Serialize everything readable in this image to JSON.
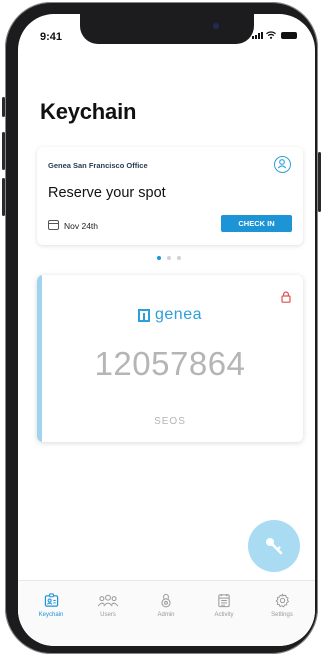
{
  "status_bar": {
    "time": "9:41"
  },
  "page": {
    "title": "Keychain"
  },
  "reservation_card": {
    "office": "Genea San Francisco Office",
    "heading": "Reserve your spot",
    "date": "Nov 24th",
    "checkin_label": "CHECK IN"
  },
  "pager": {
    "count": 3,
    "active": 1
  },
  "access_card": {
    "brand": "Genea",
    "brand_text": "Genea",
    "number": "12057864",
    "technology": "SEOS"
  },
  "tabs": [
    {
      "label": "Keychain",
      "icon": "badge-icon",
      "active": true
    },
    {
      "label": "Users",
      "icon": "users-icon",
      "active": false
    },
    {
      "label": "Admin",
      "icon": "admin-icon",
      "active": false
    },
    {
      "label": "Activity",
      "icon": "activity-icon",
      "active": false
    },
    {
      "label": "Settings",
      "icon": "gear-icon",
      "active": false
    }
  ],
  "colors": {
    "accent": "#1c94d6",
    "fab": "#a9dbf3",
    "lock": "#e0504e",
    "card_number": "#b5b5b5"
  }
}
